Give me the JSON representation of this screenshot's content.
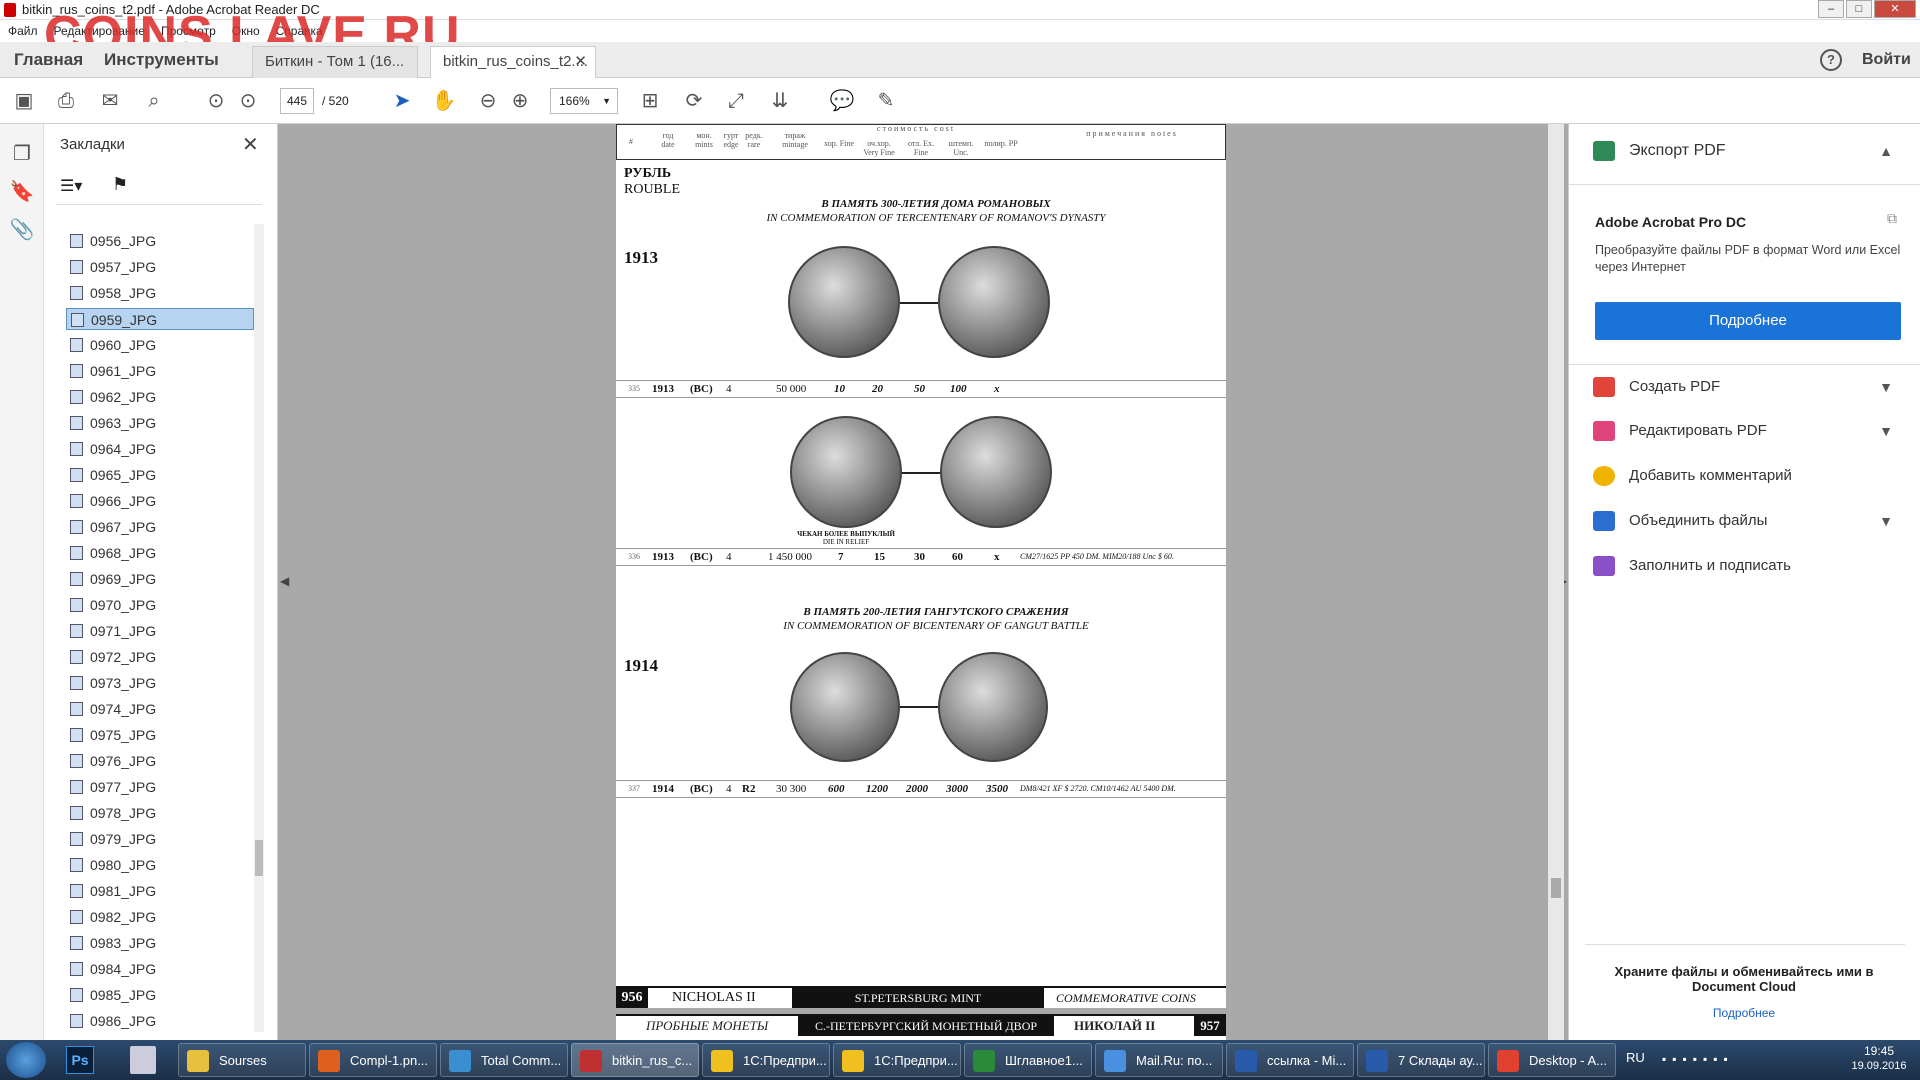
{
  "window": {
    "title": "bitkin_rus_coins_t2.pdf - Adobe Acrobat Reader DC"
  },
  "watermark": "COINS.LAVE.RU",
  "menu": [
    "Файл",
    "Редактирование",
    "Просмотр",
    "Окно",
    "Справка"
  ],
  "tabs": {
    "home": "Главная",
    "tools": "Инструменты",
    "doc1": "Биткин - Том 1 (16...",
    "doc2": "bitkin_rus_coins_t2....",
    "signin": "Войти"
  },
  "toolbar": {
    "page_current": "445",
    "page_total": "/ 520",
    "zoom": "166%"
  },
  "bookmarks": {
    "title": "Закладки",
    "items": [
      "0956_JPG",
      "0957_JPG",
      "0958_JPG",
      "0959_JPG",
      "0960_JPG",
      "0961_JPG",
      "0962_JPG",
      "0963_JPG",
      "0964_JPG",
      "0965_JPG",
      "0966_JPG",
      "0967_JPG",
      "0968_JPG",
      "0969_JPG",
      "0970_JPG",
      "0971_JPG",
      "0972_JPG",
      "0973_JPG",
      "0974_JPG",
      "0975_JPG",
      "0976_JPG",
      "0977_JPG",
      "0978_JPG",
      "0979_JPG",
      "0980_JPG",
      "0981_JPG",
      "0982_JPG",
      "0983_JPG",
      "0984_JPG",
      "0985_JPG",
      "0986_JPG"
    ],
    "selected": "0959_JPG"
  },
  "document": {
    "header_cols": [
      "#",
      "год date",
      "мон. mints",
      "гурт edge",
      "редк. rare",
      "тираж mintage",
      "хор. Fine",
      "оч.хор. Very Fine",
      "отл. Ex. Fine",
      "штемп. Unc.",
      "полир. PP"
    ],
    "header_cost": "стоимость cost",
    "header_notes": "примечания notes",
    "denom_ru": "РУБЛЬ",
    "denom_en": "ROUBLE",
    "sec1_ru": "В ПАМЯТЬ 300-ЛЕТИЯ ДОМА РОМАНОВЫХ",
    "sec1_en": "IN COMMEMORATION OF TERCENTENARY OF ROMANOV'S DYNASTY",
    "year1": "1913",
    "row335": {
      "n": "335",
      "date": "1913",
      "mint": "(ВС)",
      "edge": "4",
      "mintage": "50 000",
      "f": "10",
      "vf": "20",
      "xf": "50",
      "unc": "100",
      "pp": "x",
      "notes": ""
    },
    "relief_ru": "ЧЕКАН БОЛЕЕ ВЫПУКЛЫЙ",
    "relief_en": "DIE IN RELIEF",
    "row336": {
      "n": "336",
      "date": "1913",
      "mint": "(ВС)",
      "edge": "4",
      "mintage": "1 450 000",
      "f": "7",
      "vf": "15",
      "xf": "30",
      "unc": "60",
      "pp": "x",
      "notes": "СМ27/1625 PP 450 DM. MIM20/188 Unc $ 60."
    },
    "sec2_ru": "В ПАМЯТЬ 200-ЛЕТИЯ ГАНГУТСКОГО СРАЖЕНИЯ",
    "sec2_en": "IN COMMEMORATION OF BICENTENARY OF GANGUT BATTLE",
    "year2": "1914",
    "row337": {
      "n": "337",
      "date": "1914",
      "mint": "(ВС)",
      "edge": "4",
      "rare": "R2",
      "mintage": "30 300",
      "f": "600",
      "vf": "1200",
      "xf": "2000",
      "unc": "3000",
      "pp": "3500",
      "notes": "DM8/421 XF $ 2720. СМ10/1462 AU 5400 DM."
    },
    "footer": {
      "page": "956",
      "ruler": "NICHOLAS II",
      "mint": "ST.PETERSBURG MINT",
      "type": "COMMEMORATIVE COINS"
    },
    "next_header": {
      "type": "ПРОБНЫЕ МОНЕТЫ",
      "mint": "С.-ПЕТЕРБУРГСКИЙ МОНЕТНЫЙ ДВОР",
      "ruler": "НИКОЛАЙ II",
      "page": "957"
    }
  },
  "rightpanel": {
    "export": "Экспорт PDF",
    "product": "Adobe Acrobat Pro DC",
    "desc": "Преобразуйте файлы PDF в формат Word или Excel через Интернет",
    "button": "Подробнее",
    "items": [
      "Создать PDF",
      "Редактировать PDF",
      "Добавить комментарий",
      "Объединить файлы",
      "Заполнить и подписать"
    ],
    "promo": "Храните файлы и обменивайтесь ими в Document Cloud",
    "promo_link": "Подробнее",
    "colors": {
      "accent": "#1a73d6",
      "create": "#e0443a",
      "edit": "#e0447a",
      "comment": "#f0b400",
      "combine": "#2a6fd0",
      "sign": "#8a50c8"
    }
  },
  "taskbar": {
    "items": [
      "Sourses",
      "Compl-1.pn...",
      "Total Comm...",
      "bitkin_rus_c...",
      "1С:Предпри...",
      "1С:Предпри...",
      "Шглавное1...",
      "Mail.Ru: по...",
      "ссылка - Mi...",
      "7 Склады ау...",
      "Desktop - A..."
    ],
    "lang": "RU",
    "time": "19:45",
    "date": "19.09.2016"
  }
}
